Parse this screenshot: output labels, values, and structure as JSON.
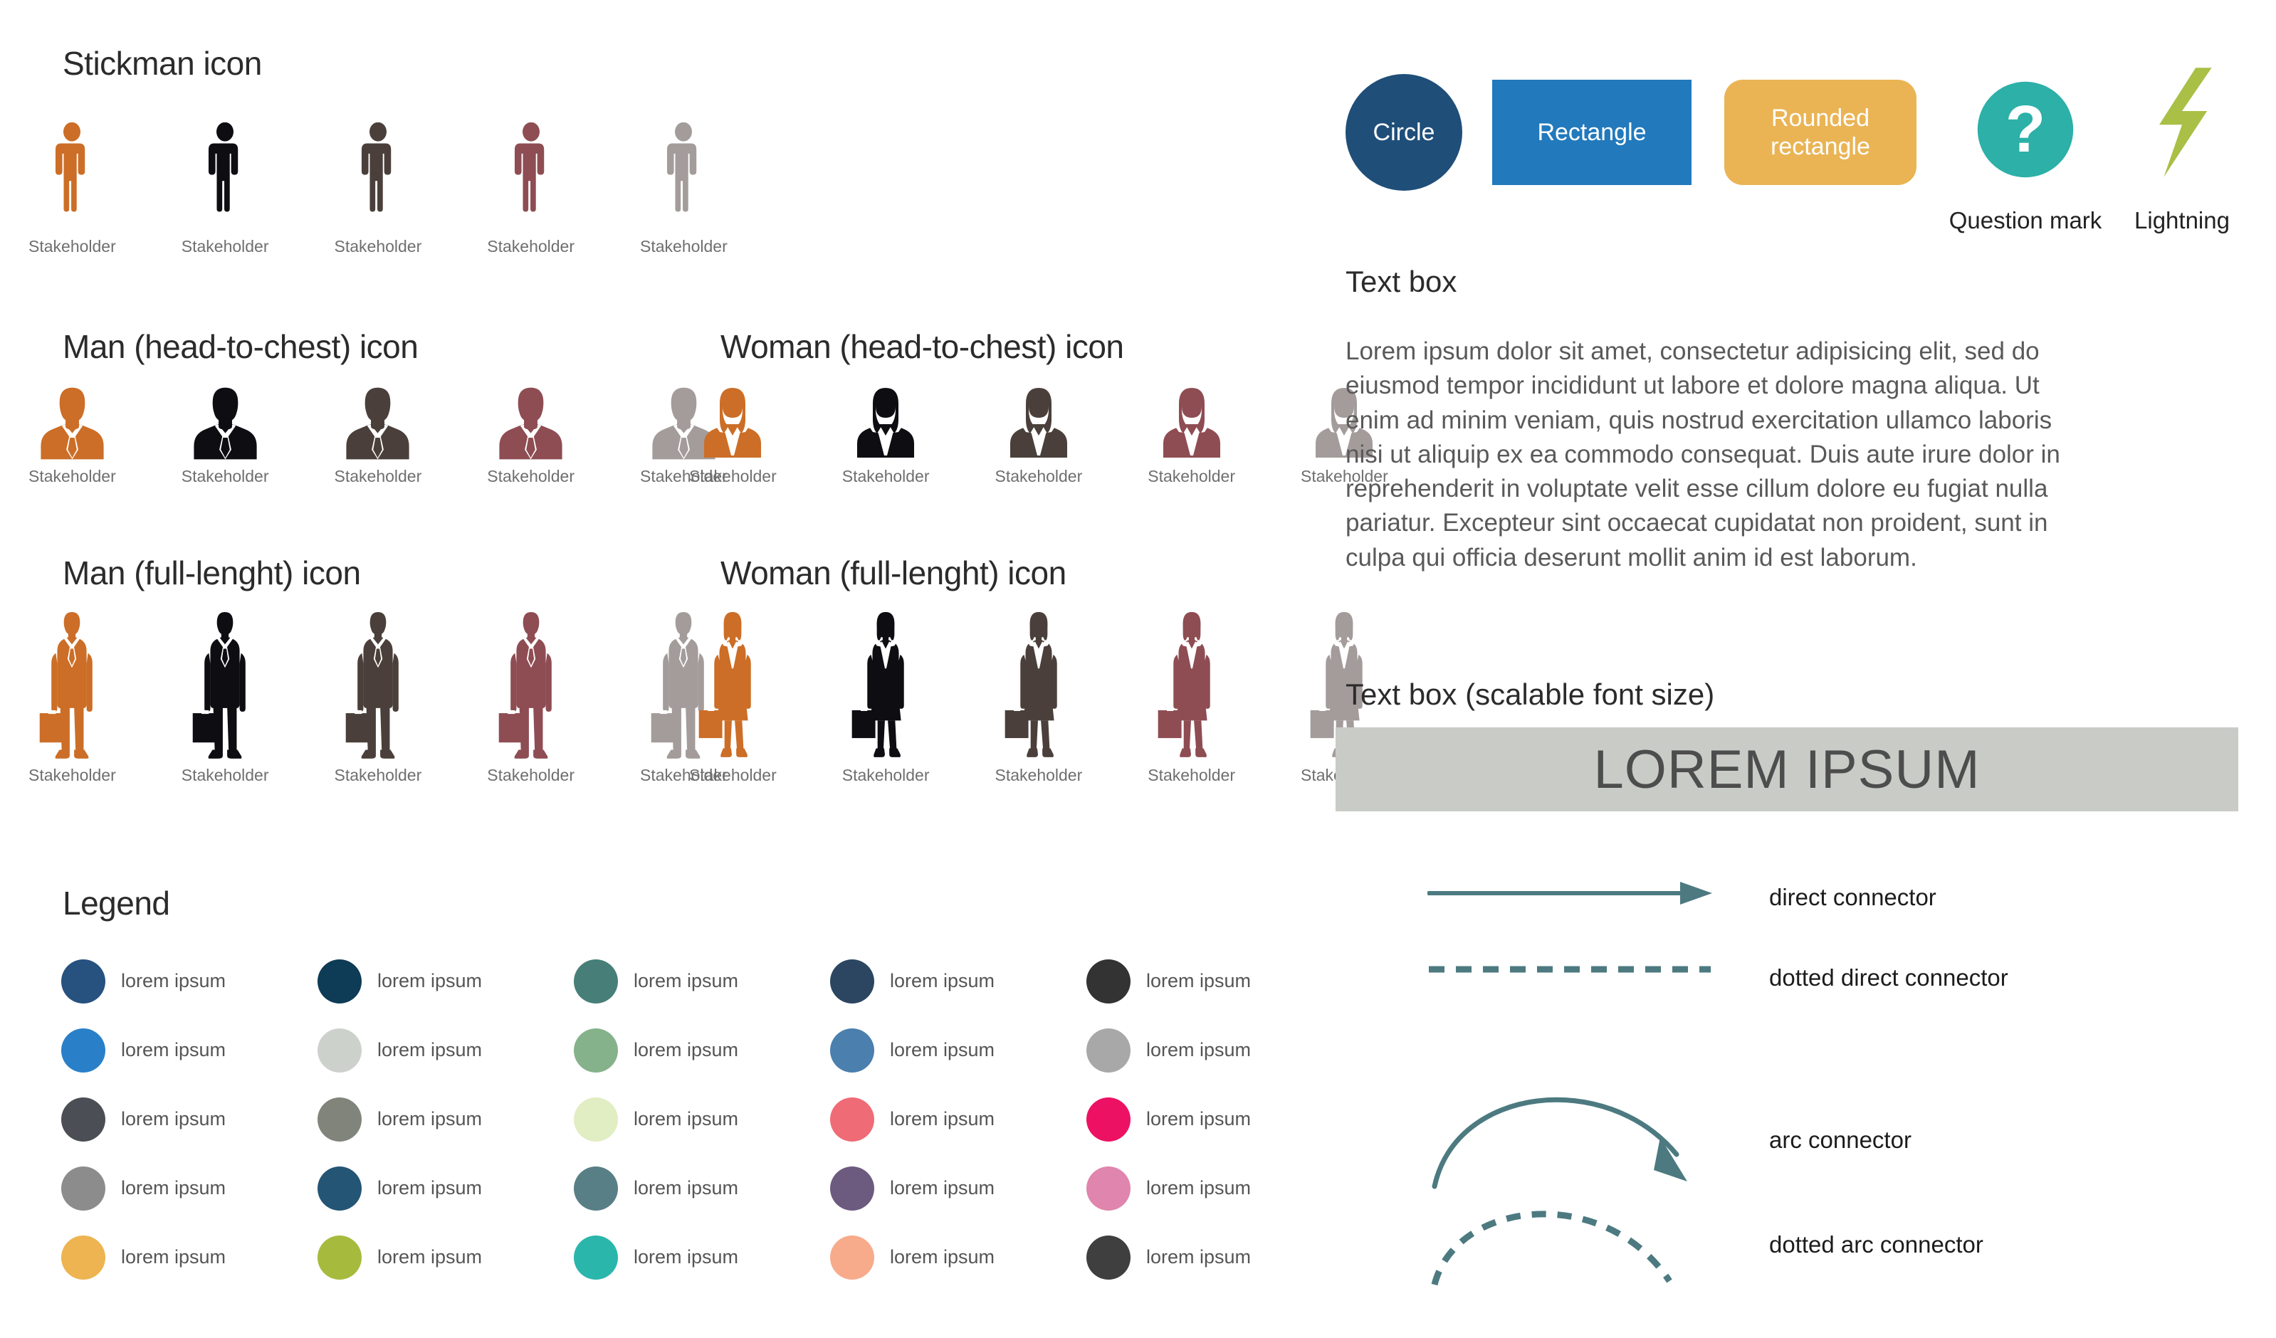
{
  "sections": {
    "stickman": {
      "title": "Stickman icon"
    },
    "man_head": {
      "title": "Man (head-to-chest) icon"
    },
    "woman_head": {
      "title": "Woman (head-to-chest) icon"
    },
    "man_full": {
      "title": "Man (full-lenght) icon"
    },
    "woman_full": {
      "title": "Woman (full-lenght) icon"
    },
    "legend": {
      "title": "Legend"
    },
    "textbox": {
      "title": "Text box"
    },
    "textbox_scalable": {
      "title": "Text box (scalable font size)"
    }
  },
  "person_label": "Stakeholder",
  "person_colors": [
    "#cc6e27",
    "#0d0d12",
    "#4a3f3a",
    "#8e4d53",
    "#a39c9b"
  ],
  "people": {
    "stickman": [
      {
        "label": "Stakeholder",
        "color": "#cc6e27"
      },
      {
        "label": "Stakeholder",
        "color": "#0d0d12"
      },
      {
        "label": "Stakeholder",
        "color": "#4a3f3a"
      },
      {
        "label": "Stakeholder",
        "color": "#8e4d53"
      },
      {
        "label": "Stakeholder",
        "color": "#a39c9b"
      }
    ],
    "man_head": [
      {
        "label": "Stakeholder",
        "color": "#cc6e27"
      },
      {
        "label": "Stakeholder",
        "color": "#0d0d12"
      },
      {
        "label": "Stakeholder",
        "color": "#4a3f3a"
      },
      {
        "label": "Stakeholder",
        "color": "#8e4d53"
      },
      {
        "label": "Stakeholder",
        "color": "#a39c9b"
      }
    ],
    "woman_head": [
      {
        "label": "Stakeholder",
        "color": "#cc6e27"
      },
      {
        "label": "Stakeholder",
        "color": "#0d0d12"
      },
      {
        "label": "Stakeholder",
        "color": "#4a3f3a"
      },
      {
        "label": "Stakeholder",
        "color": "#8e4d53"
      },
      {
        "label": "Stakeholder",
        "color": "#a39c9b"
      }
    ],
    "man_full": [
      {
        "label": "Stakeholder",
        "color": "#cc6e27"
      },
      {
        "label": "Stakeholder",
        "color": "#0d0d12"
      },
      {
        "label": "Stakeholder",
        "color": "#4a3f3a"
      },
      {
        "label": "Stakeholder",
        "color": "#8e4d53"
      },
      {
        "label": "Stakeholder",
        "color": "#a39c9b"
      }
    ],
    "woman_full": [
      {
        "label": "Stakeholder",
        "color": "#cc6e27"
      },
      {
        "label": "Stakeholder",
        "color": "#0d0d12"
      },
      {
        "label": "Stakeholder",
        "color": "#4a3f3a"
      },
      {
        "label": "Stakeholder",
        "color": "#8e4d53"
      },
      {
        "label": "Stakeholder",
        "color": "#a39c9b"
      }
    ]
  },
  "legend_label": "lorem ipsum",
  "legend_items": [
    {
      "label": "lorem ipsum",
      "color": "#27517f"
    },
    {
      "label": "lorem ipsum",
      "color": "#0e3b55"
    },
    {
      "label": "lorem ipsum",
      "color": "#477f78"
    },
    {
      "label": "lorem ipsum",
      "color": "#2c4661"
    },
    {
      "label": "lorem ipsum",
      "color": "#333333"
    },
    {
      "label": "lorem ipsum",
      "color": "#2980c9"
    },
    {
      "label": "lorem ipsum",
      "color": "#cdd1cc"
    },
    {
      "label": "lorem ipsum",
      "color": "#85b28b"
    },
    {
      "label": "lorem ipsum",
      "color": "#4a7fae"
    },
    {
      "label": "lorem ipsum",
      "color": "#a8a8a8"
    },
    {
      "label": "lorem ipsum",
      "color": "#4b4f55"
    },
    {
      "label": "lorem ipsum",
      "color": "#81847a"
    },
    {
      "label": "lorem ipsum",
      "color": "#e1edc2"
    },
    {
      "label": "lorem ipsum",
      "color": "#ef6b76"
    },
    {
      "label": "lorem ipsum",
      "color": "#ed1164"
    },
    {
      "label": "lorem ipsum",
      "color": "#8c8c8c"
    },
    {
      "label": "lorem ipsum",
      "color": "#255575"
    },
    {
      "label": "lorem ipsum",
      "color": "#587f85"
    },
    {
      "label": "lorem ipsum",
      "color": "#6c5b7f"
    },
    {
      "label": "lorem ipsum",
      "color": "#e085ad"
    },
    {
      "label": "lorem ipsum",
      "color": "#edb451"
    },
    {
      "label": "lorem ipsum",
      "color": "#a6bb3e"
    },
    {
      "label": "lorem ipsum",
      "color": "#2bb6ac"
    },
    {
      "label": "lorem ipsum",
      "color": "#f7ab8b"
    },
    {
      "label": "lorem ipsum",
      "color": "#403f3f"
    }
  ],
  "shapes": [
    {
      "name": "circle",
      "label": "Circle",
      "color": "#1f4e79",
      "text_color": "#ffffff"
    },
    {
      "name": "rectangle",
      "label": "Rectangle",
      "color": "#2279bc",
      "text_color": "#ffffff"
    },
    {
      "name": "rounded-rectangle",
      "label": "Rounded rectangle",
      "color": "#eab455",
      "text_color": "#ffffff"
    },
    {
      "name": "question-mark",
      "label": "Question mark",
      "color": "#2cb0a8",
      "text_color": "#ffffff"
    },
    {
      "name": "lightning",
      "label": "Lightning",
      "color": "#a9bf46",
      "text_color": "#222222"
    }
  ],
  "textbox_body": "Lorem ipsum dolor sit amet, consectetur adipisicing elit, sed do eiusmod tempor incididunt ut labore et dolore magna aliqua. Ut enim ad minim veniam, quis nostrud exercitation ullamco laboris nisi ut aliquip ex ea commodo consequat. Duis aute irure dolor in reprehenderit in voluptate velit esse cillum dolore eu fugiat nulla pariatur. Excepteur sint occaecat cupidatat non proident, sunt in culpa qui officia deserunt mollit anim id est laborum.",
  "scalable": {
    "text": "LOREM IPSUM",
    "background": "#c9cbc7",
    "text_color": "#4d4d4d"
  },
  "connectors": {
    "color": "#4c7a80",
    "items": [
      {
        "name": "direct-connector",
        "label": "direct connector"
      },
      {
        "name": "dotted-direct-connector",
        "label": "dotted direct connector"
      },
      {
        "name": "arc-connector",
        "label": "arc connector"
      },
      {
        "name": "dotted-arc-connector",
        "label": "dotted arc connector"
      }
    ]
  }
}
